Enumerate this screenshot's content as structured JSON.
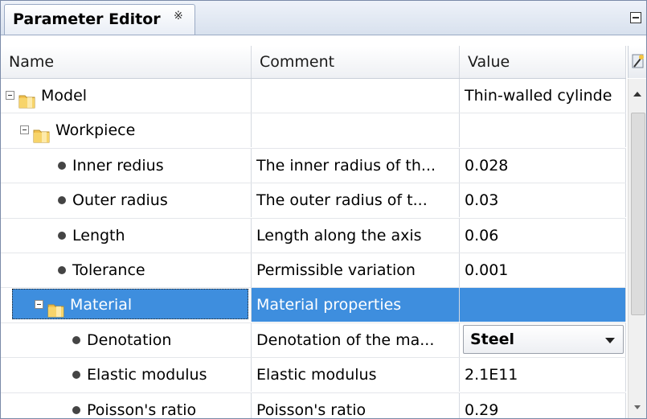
{
  "panel": {
    "tab_title": "Parameter Editor",
    "tab_close_glyph": "※"
  },
  "columns": {
    "name": "Name",
    "comment": "Comment",
    "value": "Value"
  },
  "rows": [
    {
      "type": "folder",
      "level": 0,
      "name": "Model",
      "comment": "",
      "value": "Thin-walled cylinde",
      "expanded": true
    },
    {
      "type": "folder",
      "level": 1,
      "name": "Workpiece",
      "comment": "",
      "value": "",
      "expanded": true
    },
    {
      "type": "param",
      "level": 2,
      "name": "Inner redius",
      "comment": "The inner radius of th...",
      "value": "0.028"
    },
    {
      "type": "param",
      "level": 2,
      "name": "Outer radius",
      "comment": "The outer radius of t...",
      "value": "0.03"
    },
    {
      "type": "param",
      "level": 2,
      "name": "Length",
      "comment": "Length along the axis",
      "value": "0.06"
    },
    {
      "type": "param",
      "level": 2,
      "name": "Tolerance",
      "comment": "Permissible variation",
      "value": "0.001"
    },
    {
      "type": "folder",
      "level": 2,
      "name": "Material",
      "comment": "Material properties",
      "value": "",
      "expanded": true,
      "selected": true
    },
    {
      "type": "param",
      "level": 3,
      "name": "Denotation",
      "comment": "Denotation of the ma...",
      "value": "Steel",
      "dropdown": true
    },
    {
      "type": "param",
      "level": 3,
      "name": "Elastic modulus",
      "comment": "Elastic modulus",
      "value": "2.1E11"
    },
    {
      "type": "param",
      "level": 3,
      "name": "Poisson's ratio",
      "comment": "Poisson's ratio",
      "value": "0.29"
    }
  ],
  "icons": {
    "folder": "folder-icon",
    "toggle": "collapse-icon",
    "bullet": "parameter-bullet-icon",
    "wand": "magic-wand-icon",
    "minimize": "minimize-icon",
    "dropdown": "chevron-down-icon"
  },
  "colors": {
    "selection": "#3e8ede",
    "folder": "#f2c14e"
  }
}
